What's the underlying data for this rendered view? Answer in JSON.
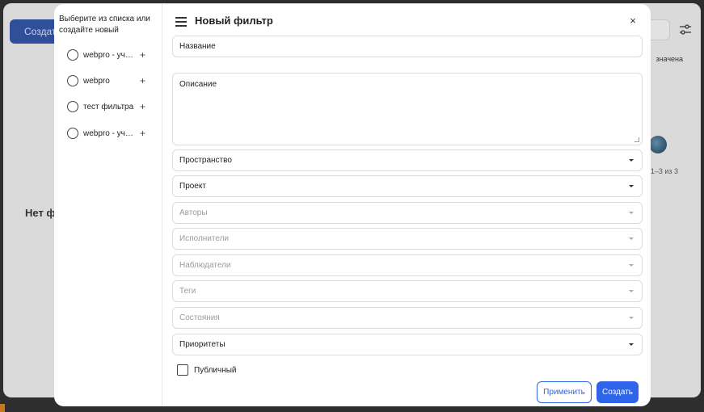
{
  "background": {
    "create_button": "Создать",
    "assigned_text": "значена",
    "pagination": "1–3 из 3",
    "no_filters_text": "Нет фи"
  },
  "modal": {
    "left_title": "Выберите из списка или создайте новый",
    "saved_filters": [
      {
        "label": "webpro - уча…",
        "plus": "+"
      },
      {
        "label": "webpro",
        "plus": "+"
      },
      {
        "label": "тест фильтра",
        "plus": "+"
      },
      {
        "label": "webpro - уча…",
        "plus": "+"
      }
    ],
    "title": "Новый фильтр",
    "close": "×",
    "fields": {
      "name_placeholder": "Название",
      "description_placeholder": "Описание",
      "space": "Пространство",
      "project": "Проект",
      "authors": "Авторы",
      "assignees": "Исполнители",
      "watchers": "Наблюдатели",
      "tags": "Теги",
      "states": "Состояния",
      "priorities": "Приоритеты"
    },
    "public_label": "Публичный",
    "apply_button": "Применить",
    "create_button": "Создать"
  },
  "colors": {
    "accent": "#2f63ea",
    "overlay_bg": "#2e2e2e"
  }
}
